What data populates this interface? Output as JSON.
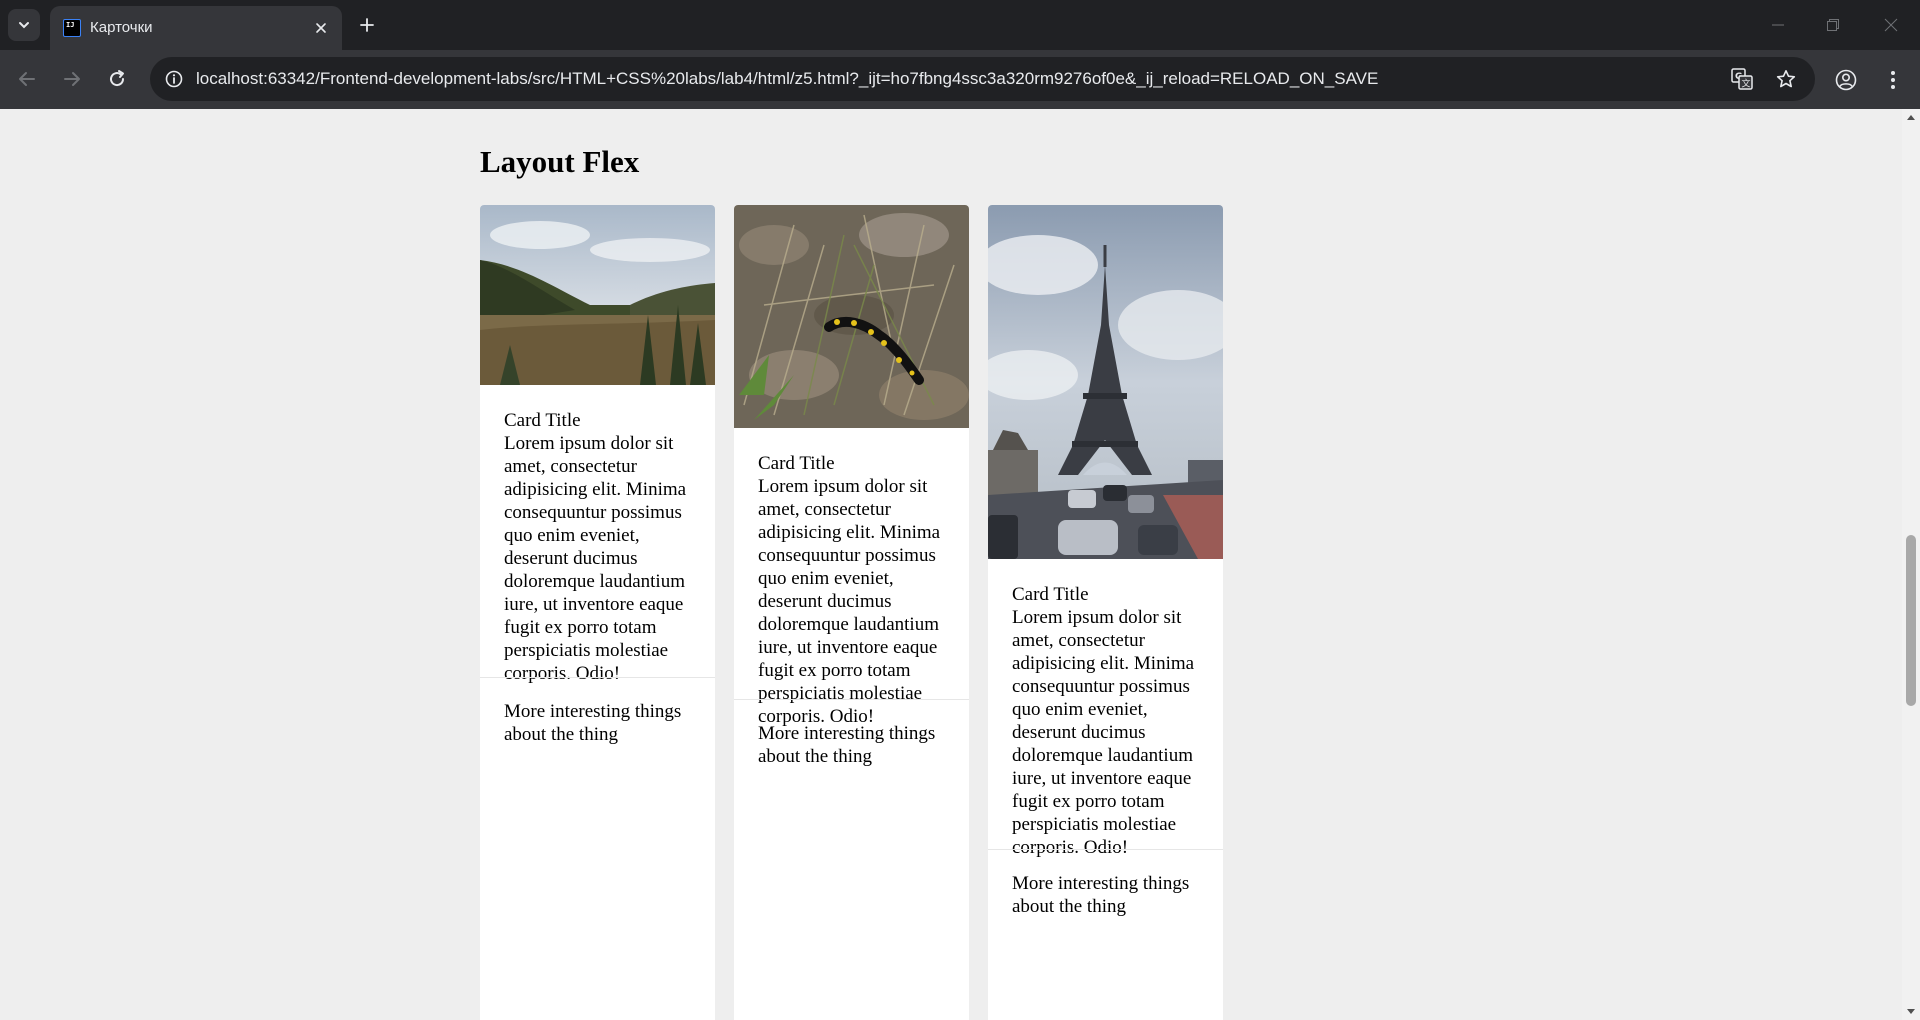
{
  "browser": {
    "tab": {
      "title": "Карточки",
      "favicon_text": "IJ"
    },
    "url": "localhost:63342/Frontend-development-labs/src/HTML+CSS%20labs/lab4/html/z5.html?_ijt=ho7fbng4ssc3a320rm9276of0e&_ij_reload=RELOAD_ON_SAVE",
    "icons": [
      "tab-search-icon",
      "close-icon",
      "plus-icon",
      "minimize-icon",
      "restore-icon",
      "close-window-icon",
      "back-arrow-icon",
      "forward-arrow-icon",
      "reload-icon",
      "site-info-icon",
      "translate-icon",
      "star-icon",
      "profile-icon",
      "kebab-menu-icon"
    ]
  },
  "page": {
    "title": "Layout Flex",
    "cards": [
      {
        "image": "landscape-photo",
        "title": "Card Title",
        "text": "Lorem ipsum dolor sit amet, consectetur adipisicing elit. Minima consequuntur possimus quo enim eveniet, deserunt ducimus doloremque laudantium iure, ut inventore eaque fugit ex porro totam perspiciatis molestiae corporis. Odio!",
        "footer": "More interesting things about the thing"
      },
      {
        "image": "salamander-photo",
        "title": "Card Title",
        "text": "Lorem ipsum dolor sit amet, consectetur adipisicing elit. Minima consequuntur possimus quo enim eveniet, deserunt ducimus doloremque laudantium iure, ut inventore eaque fugit ex porro totam perspiciatis molestiae corporis. Odio!",
        "footer": "More interesting things about the thing"
      },
      {
        "image": "eiffel-tower-photo",
        "title": "Card Title",
        "text": "Lorem ipsum dolor sit amet, consectetur adipisicing elit. Minima consequuntur possimus quo enim eveniet, deserunt ducimus doloremque laudantium iure, ut inventore eaque fugit ex porro totam perspiciatis molestiae corporis. Odio!",
        "footer": "More interesting things about the thing"
      }
    ]
  },
  "colors": {
    "chrome_dark": "#202124",
    "chrome_toolbar": "#35363a",
    "page_background": "#eeeeee",
    "card_background": "#ffffff"
  }
}
